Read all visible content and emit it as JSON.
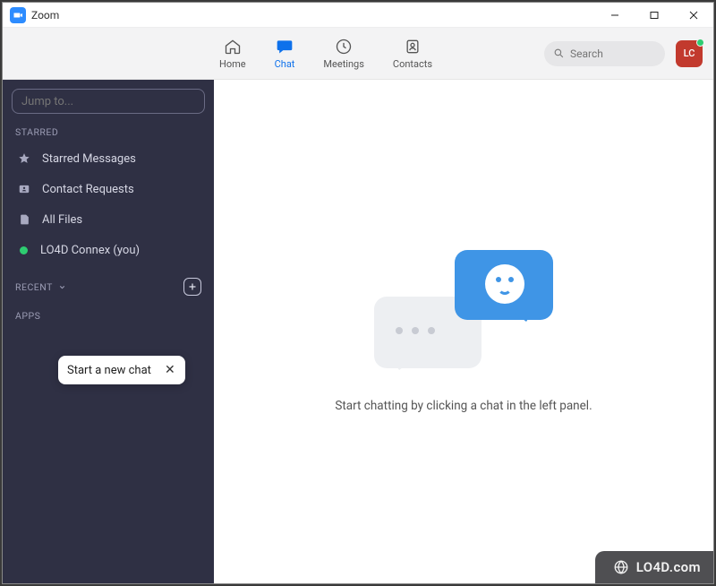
{
  "window": {
    "title": "Zoom"
  },
  "nav": {
    "tabs": [
      {
        "label": "Home"
      },
      {
        "label": "Chat"
      },
      {
        "label": "Meetings"
      },
      {
        "label": "Contacts"
      }
    ],
    "search_placeholder": "Search",
    "avatar_initials": "LC"
  },
  "sidebar": {
    "jump_placeholder": "Jump to...",
    "sections": {
      "starred_label": "STARRED",
      "recent_label": "RECENT",
      "apps_label": "APPS"
    },
    "starred_items": [
      {
        "label": "Starred Messages"
      },
      {
        "label": "Contact Requests"
      },
      {
        "label": "All Files"
      },
      {
        "label": "LO4D Connex (you)"
      }
    ],
    "tooltip": {
      "text": "Start a new chat"
    }
  },
  "main": {
    "empty_text": "Start chatting by clicking a chat in the left panel."
  },
  "watermark": {
    "text": "LO4D.com"
  }
}
